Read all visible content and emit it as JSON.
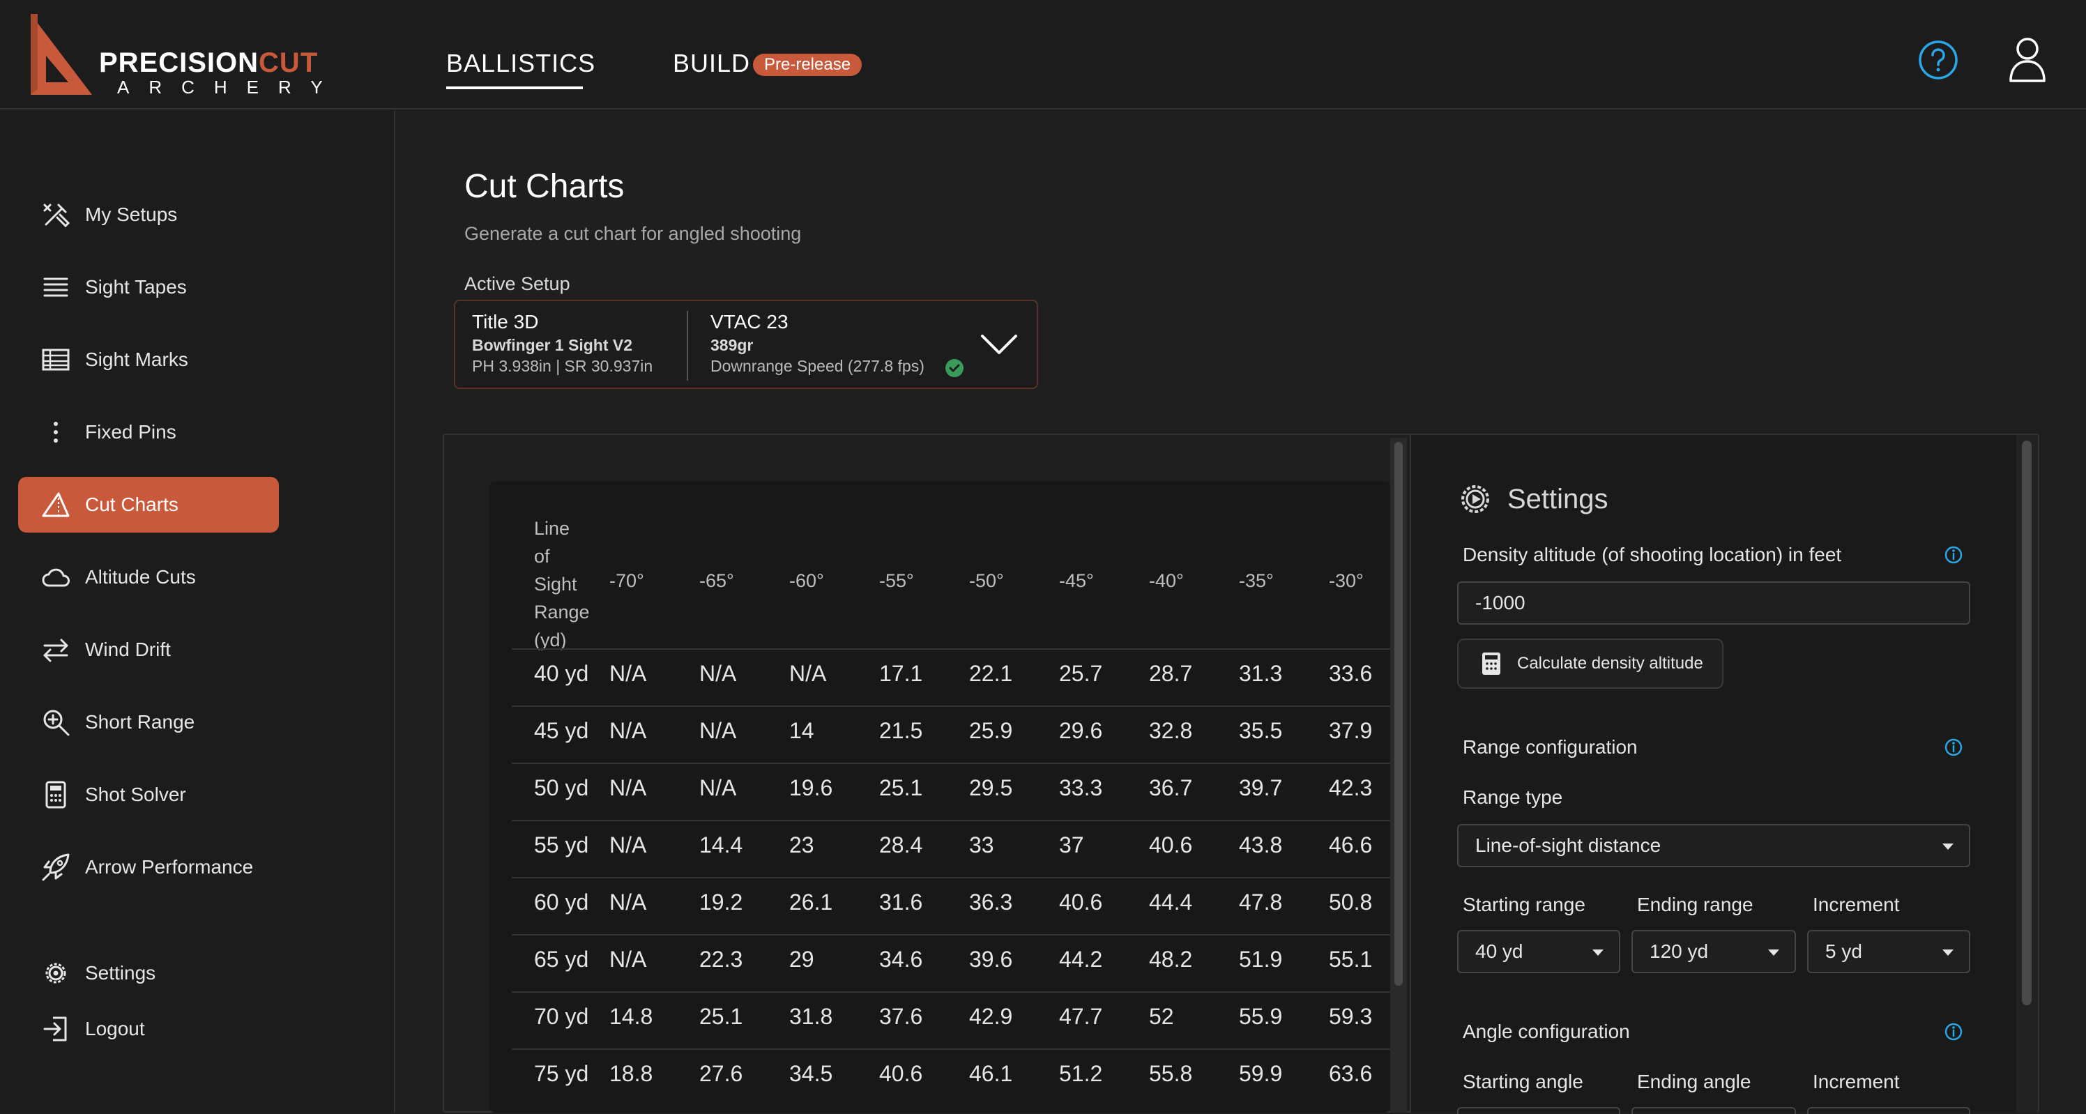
{
  "header": {
    "logo": {
      "word1": "PRECISION",
      "word2": "CUT",
      "word3": "ARCHERY"
    },
    "nav": {
      "ballistics": "BALLISTICS",
      "build": "BUILD",
      "build_badge": "Pre-release"
    },
    "icons": [
      "help-icon",
      "user-icon"
    ],
    "accent_color": "#c8593b"
  },
  "sidebar": {
    "items": [
      {
        "label": "My Setups",
        "icon": "tools-icon"
      },
      {
        "label": "Sight Tapes",
        "icon": "lines-icon"
      },
      {
        "label": "Sight Marks",
        "icon": "table-icon"
      },
      {
        "label": "Fixed Pins",
        "icon": "dots-icon"
      },
      {
        "label": "Cut Charts",
        "icon": "triangle-icon",
        "active": true
      },
      {
        "label": "Altitude Cuts",
        "icon": "cloud-icon"
      },
      {
        "label": "Wind Drift",
        "icon": "arrows-icon"
      },
      {
        "label": "Short Range",
        "icon": "zoom-icon"
      },
      {
        "label": "Shot Solver",
        "icon": "calculator-icon"
      },
      {
        "label": "Arrow Performance",
        "icon": "rocket-icon"
      }
    ],
    "footer": {
      "settings": "Settings",
      "logout": "Logout"
    }
  },
  "main": {
    "title": "Cut Charts",
    "subtitle": "Generate a cut chart for angled shooting",
    "active_setup_label": "Active Setup",
    "setup": {
      "bow_title": "Title 3D",
      "sight": "Bowfinger 1 Sight V2",
      "dims": "PH 3.938in | SR 30.937in",
      "arrow_title": "VTAC 23",
      "arrow_weight": "389gr",
      "speed": "Downrange Speed (277.8 fps)"
    },
    "table": {
      "first_header": [
        "Line",
        "of",
        "Sight",
        "Range",
        "(yd)"
      ],
      "angle_headers": [
        "-70°",
        "-65°",
        "-60°",
        "-55°",
        "-50°",
        "-45°",
        "-40°",
        "-35°",
        "-30°"
      ],
      "rows": [
        {
          "range": "40 yd",
          "values": [
            "N/A",
            "N/A",
            "N/A",
            "17.1",
            "22.1",
            "25.7",
            "28.7",
            "31.3",
            "33.6"
          ]
        },
        {
          "range": "45 yd",
          "values": [
            "N/A",
            "N/A",
            "14",
            "21.5",
            "25.9",
            "29.6",
            "32.8",
            "35.5",
            "37.9"
          ]
        },
        {
          "range": "50 yd",
          "values": [
            "N/A",
            "N/A",
            "19.6",
            "25.1",
            "29.5",
            "33.3",
            "36.7",
            "39.7",
            "42.3"
          ]
        },
        {
          "range": "55 yd",
          "values": [
            "N/A",
            "14.4",
            "23",
            "28.4",
            "33",
            "37",
            "40.6",
            "43.8",
            "46.6"
          ]
        },
        {
          "range": "60 yd",
          "values": [
            "N/A",
            "19.2",
            "26.1",
            "31.6",
            "36.3",
            "40.6",
            "44.4",
            "47.8",
            "50.8"
          ]
        },
        {
          "range": "65 yd",
          "values": [
            "N/A",
            "22.3",
            "29",
            "34.6",
            "39.6",
            "44.2",
            "48.2",
            "51.9",
            "55.1"
          ]
        },
        {
          "range": "70 yd",
          "values": [
            "14.8",
            "25.1",
            "31.8",
            "37.6",
            "42.9",
            "47.7",
            "52",
            "55.9",
            "59.3"
          ]
        },
        {
          "range": "75 yd",
          "values": [
            "18.8",
            "27.6",
            "34.5",
            "40.6",
            "46.1",
            "51.2",
            "55.8",
            "59.9",
            "63.6"
          ]
        }
      ]
    }
  },
  "settings": {
    "title": "Settings",
    "density_label": "Density altitude (of shooting location) in feet",
    "density_value": "-1000",
    "calc_button": "Calculate density altitude",
    "range_config": "Range configuration",
    "range_type_label": "Range type",
    "range_type_value": "Line-of-sight distance",
    "starting_range_label": "Starting range",
    "starting_range_value": "40 yd",
    "ending_range_label": "Ending range",
    "ending_range_value": "120 yd",
    "increment_label": "Increment",
    "increment_value": "5 yd",
    "angle_config": "Angle configuration",
    "starting_angle_label": "Starting angle",
    "ending_angle_label": "Ending angle",
    "angle_increment_label": "Increment"
  }
}
